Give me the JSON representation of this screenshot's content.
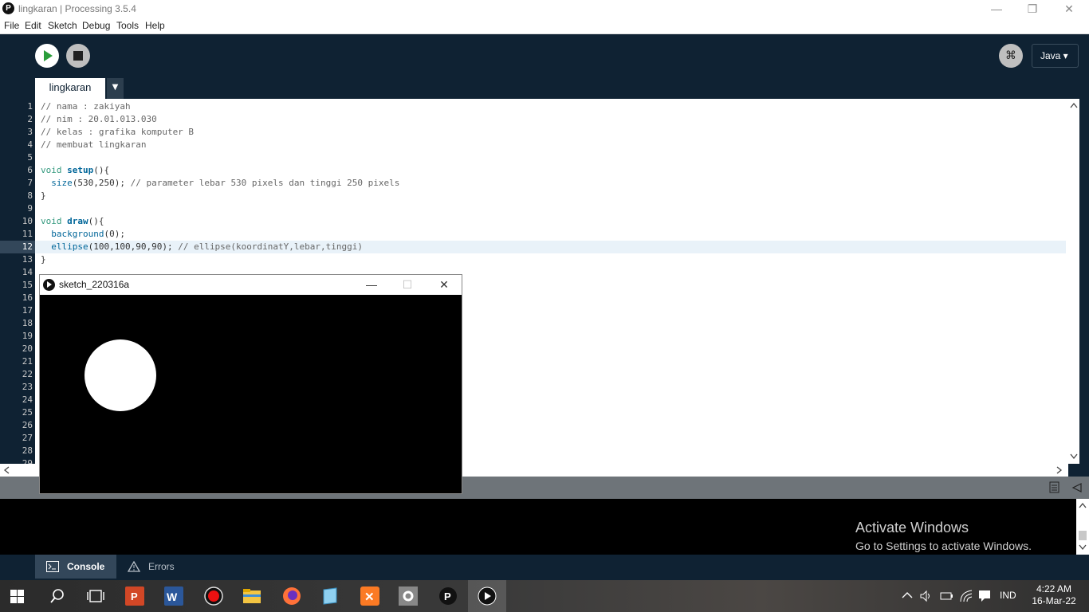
{
  "window": {
    "title": "lingkaran | Processing 3.5.4",
    "logo": "P",
    "minimize": "—",
    "restore": "❐",
    "close": "✕"
  },
  "menu": [
    "File",
    "Edit",
    "Sketch",
    "Debug",
    "Tools",
    "Help"
  ],
  "toolbar": {
    "run_icon": "play-icon",
    "stop_icon": "stop-icon",
    "debug_icon": "debug-icon",
    "mode_label": "Java ▾"
  },
  "tabs": {
    "active": "lingkaran",
    "menu_arrow": "▼"
  },
  "editor": {
    "line_numbers": [
      "1",
      "2",
      "3",
      "4",
      "5",
      "6",
      "7",
      "8",
      "9",
      "10",
      "11",
      "12",
      "13",
      "14",
      "15",
      "16",
      "17",
      "18",
      "19",
      "20",
      "21",
      "22",
      "23",
      "24",
      "25",
      "26",
      "27",
      "28",
      "29"
    ],
    "current_line": 12,
    "code": {
      "l1": "// nama : zakiyah",
      "l2": "// nim : 20.01.013.030",
      "l3": "// kelas : grafika komputer B",
      "l4": "// membuat lingkaran",
      "l6_kw": "void ",
      "l6_fn": "setup",
      "l6_rest": "(){",
      "l7_indent": "  ",
      "l7_fn": "size",
      "l7_args": "(530,250); ",
      "l7_cmt": "// parameter lebar 530 pixels dan tinggi 250 pixels",
      "l8": "}",
      "l10_kw": "void ",
      "l10_fn": "draw",
      "l10_rest": "(){",
      "l11_indent": "  ",
      "l11_fn": "background",
      "l11_args": "(0);",
      "l12_indent": "  ",
      "l12_fn": "ellipse",
      "l12_args": "(100,100,90,90); ",
      "l12_cmt": "// ellipse(koordinatY,lebar,tinggi)",
      "l13": "}"
    }
  },
  "sketch_window": {
    "title": "sketch_220316a",
    "minimize": "—",
    "maximize": "☐",
    "close": "✕"
  },
  "watermark": {
    "title": "Activate Windows",
    "subtitle": "Go to Settings to activate Windows."
  },
  "footer": {
    "console_label": "Console",
    "errors_label": "Errors"
  },
  "taskbar": {
    "lang": "IND",
    "time": "4:22 AM",
    "date": "16-Mar-22"
  }
}
